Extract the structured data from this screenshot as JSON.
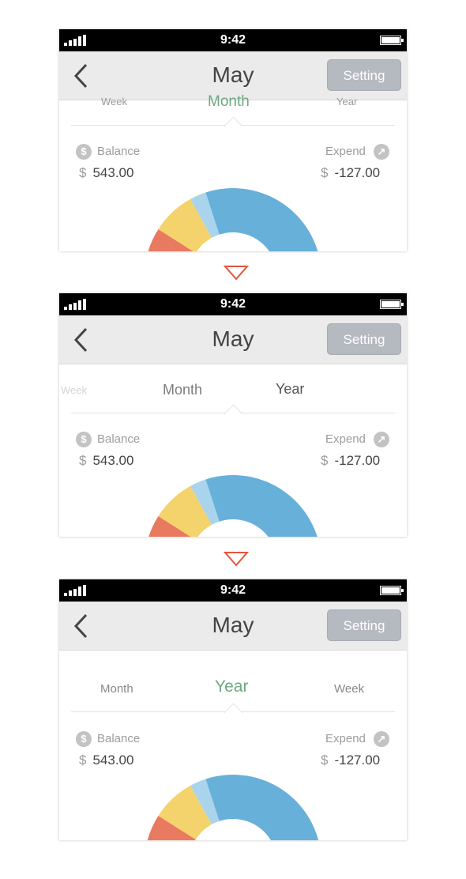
{
  "status_bar": {
    "time": "9:42"
  },
  "navbar": {
    "title": "May",
    "setting_label": "Setting"
  },
  "frames": [
    {
      "tabs": {
        "left": "Week",
        "center": "Month",
        "right": "Year"
      }
    },
    {
      "tabs": {
        "far_left": "Week",
        "center": "Month",
        "right": "Year"
      }
    },
    {
      "tabs": {
        "left": "Month",
        "center": "Year",
        "right": "Week"
      }
    }
  ],
  "summary": {
    "balance_label": "Balance",
    "balance_icon": "dollar-icon",
    "balance_currency": "$",
    "balance_value": "543.00",
    "expend_label": "Expend",
    "expend_icon": "arrow-up-right-icon",
    "expend_currency": "$",
    "expend_value": "-127.00"
  },
  "colors": {
    "accent_green": "#6ea882",
    "arrow_red": "#e4533b",
    "segment_red": "#e87a5f",
    "segment_yellow": "#f4d36c",
    "segment_light_blue": "#a9d4ec",
    "segment_blue": "#67b0da"
  },
  "chart_data": {
    "type": "pie",
    "shape": "half-donut",
    "slices": [
      {
        "color": "#e87a5f",
        "value": 18
      },
      {
        "color": "#f4d36c",
        "value": 16
      },
      {
        "color": "#a9d4ec",
        "value": 6
      },
      {
        "color": "#67b0da",
        "value": 60
      }
    ]
  }
}
